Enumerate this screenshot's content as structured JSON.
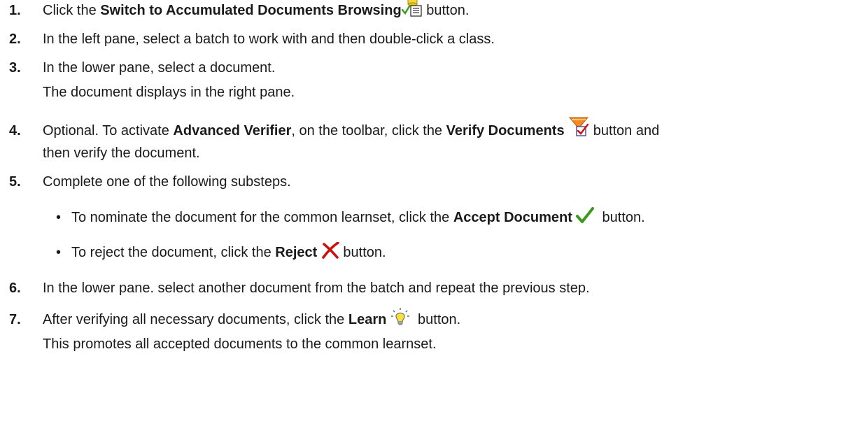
{
  "steps": [
    {
      "number": "1.",
      "pre": "Click the ",
      "bold": "Switch to Accumulated Documents Browsing",
      "post": " button."
    },
    {
      "number": "2.",
      "text": "In the left pane, select a batch to work with and then double-click a class."
    },
    {
      "number": "3.",
      "text": "In the lower pane, select a document.",
      "note": "The document displays in the right pane."
    },
    {
      "number": "4.",
      "pre": "Optional. To activate ",
      "bold1": "Advanced Verifier",
      "mid": ", on the toolbar, click the ",
      "bold2": "Verify Documents",
      "post": " button and",
      "continuation": "then verify the document."
    },
    {
      "number": "5.",
      "text": "Complete one of the following substeps.",
      "substeps": [
        {
          "bullet": "•",
          "pre": "To nominate the document for the common learnset, click the ",
          "bold": "Accept Document",
          "post": " button."
        },
        {
          "bullet": "•",
          "pre": "To reject the document, click the ",
          "bold": "Reject",
          "post": " button."
        }
      ]
    },
    {
      "number": "6.",
      "text": "In the lower pane. select another document from the batch and repeat the previous step."
    },
    {
      "number": "7.",
      "pre": "After verifying all necessary documents, click the ",
      "bold": "Learn",
      "post": " button.",
      "note": "This promotes all accepted documents to the common learnset."
    }
  ],
  "icons": {
    "step1": "switch-to-accumulated-documents-icon",
    "step4": "verify-documents-icon",
    "accept": "accept-document-icon",
    "reject": "reject-icon",
    "learn": "learn-lightbulb-icon"
  },
  "colors": {
    "accept_green": "#3a9a1c",
    "reject_red": "#cc1111",
    "verify_orange": "#f08a24",
    "learn_yellow": "#f7e23a"
  }
}
